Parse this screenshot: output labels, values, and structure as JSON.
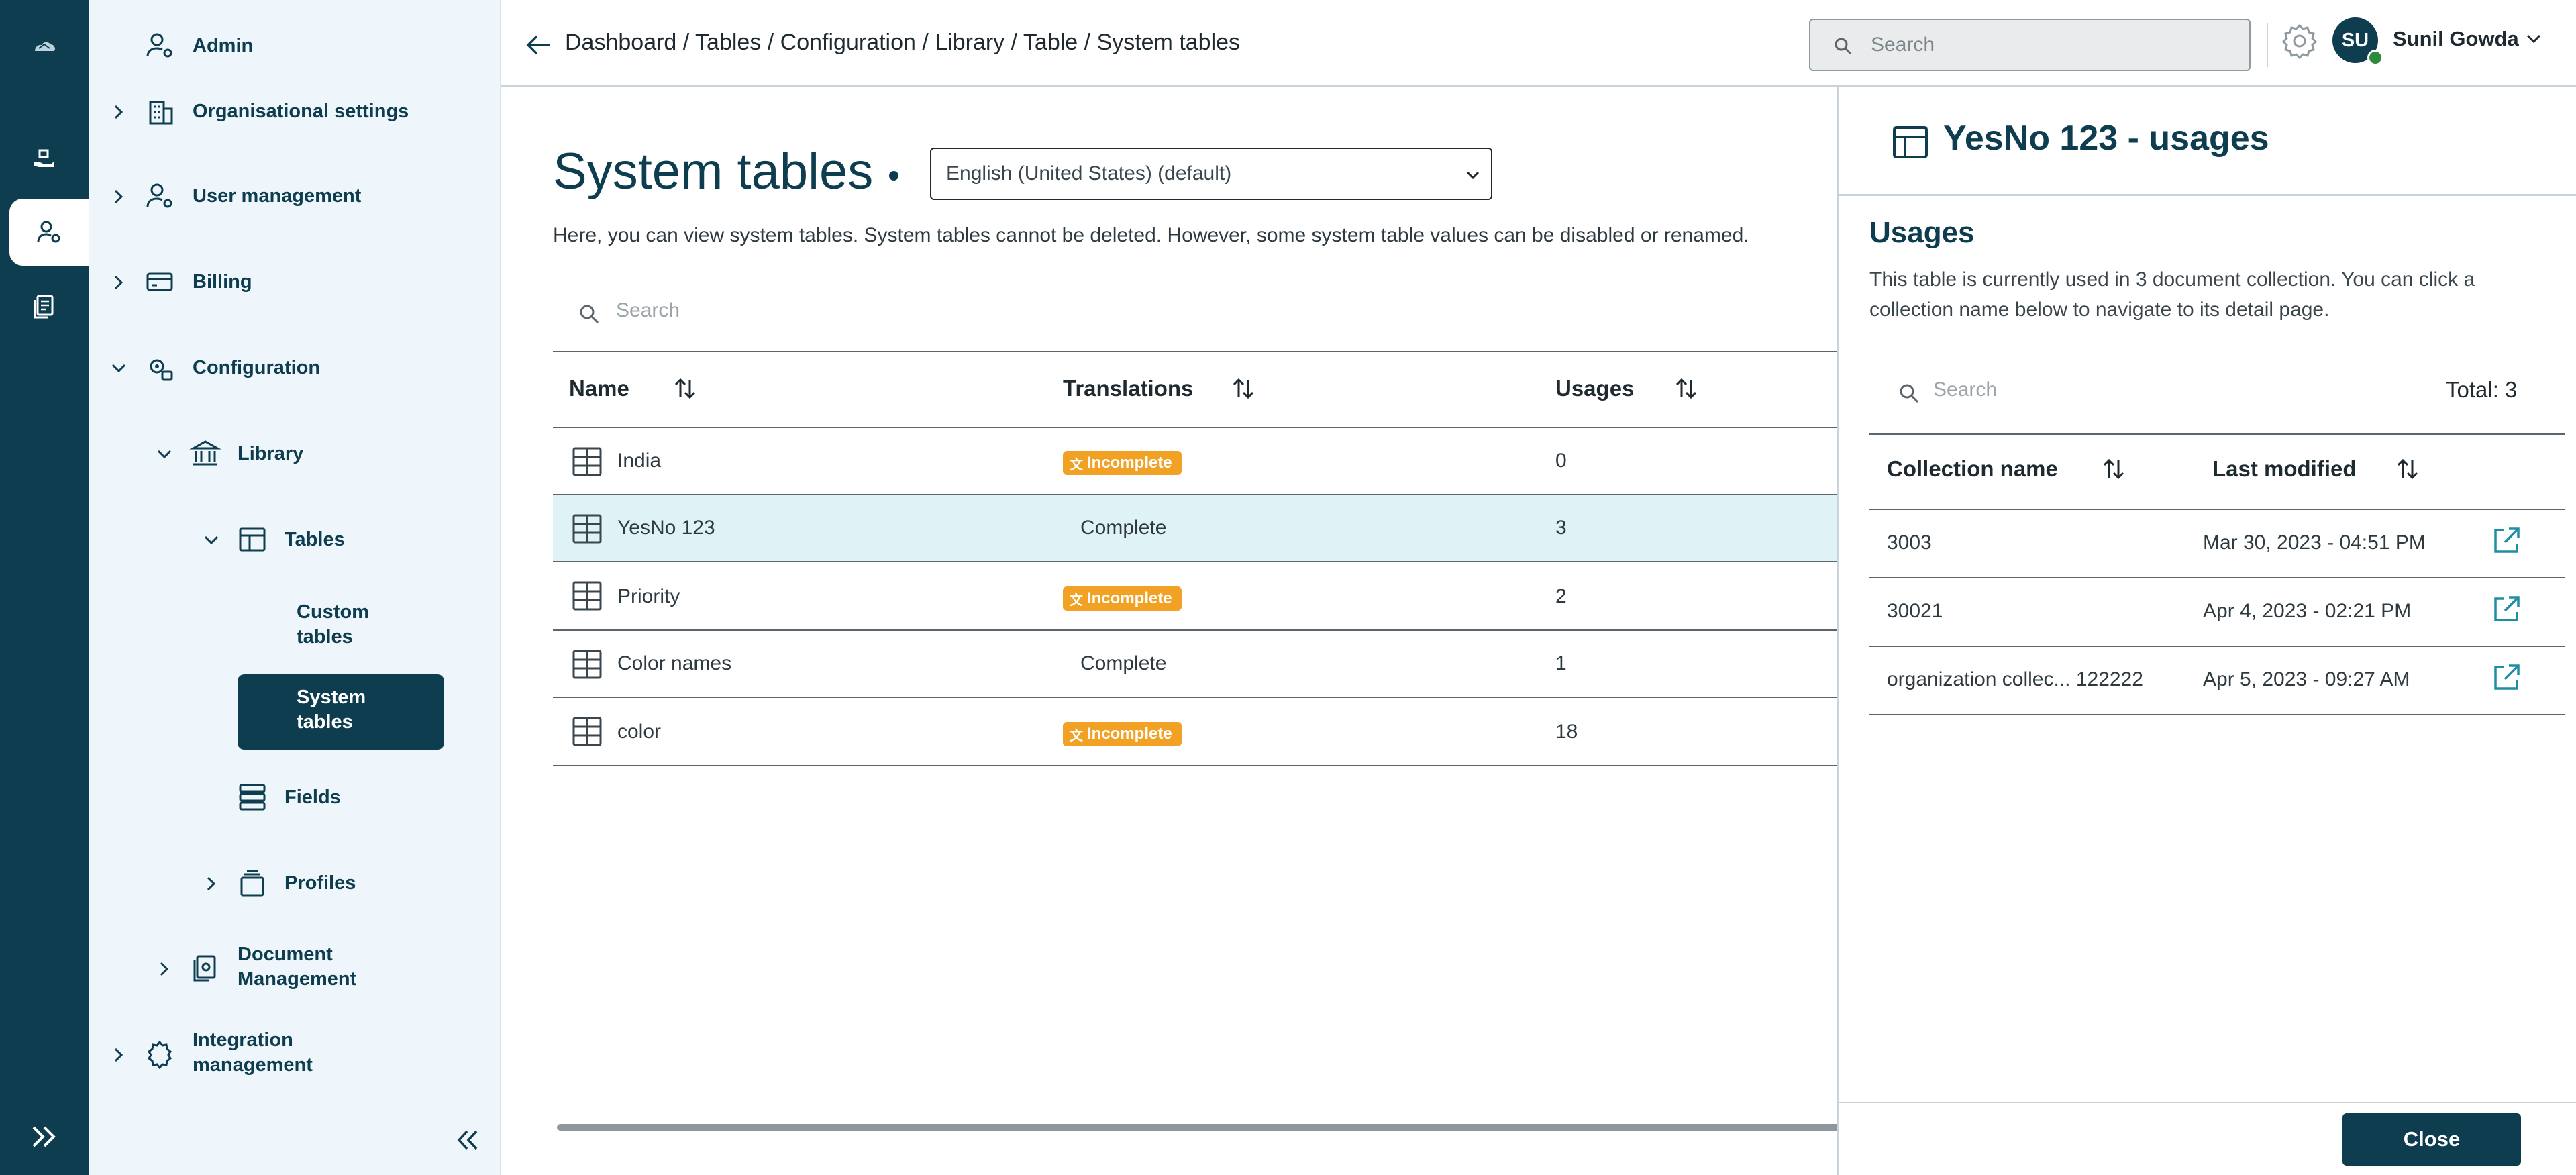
{
  "sidebar": {
    "admin": "Admin",
    "org_settings": "Organisational settings",
    "user_management": "User management",
    "billing": "Billing",
    "configuration": "Configuration",
    "library": "Library",
    "tables": "Tables",
    "custom_tables_1": "Custom",
    "custom_tables_2": "tables",
    "system_tables_1": "System",
    "system_tables_2": "tables",
    "fields": "Fields",
    "profiles": "Profiles",
    "doc_mgmt_1": "Document",
    "doc_mgmt_2": "Management",
    "integration_1": "Integration",
    "integration_2": "management"
  },
  "header": {
    "breadcrumb": "Dashboard / Tables / Configuration / Library / Table / System tables",
    "search_placeholder": "Search",
    "avatar_initials": "SU",
    "user_name": "Sunil Gowda"
  },
  "main": {
    "title": "System tables",
    "language": "English (United States) (default)",
    "description": "Here, you can view system tables. System tables cannot be deleted. However, some system table values can be disabled or renamed.",
    "search_placeholder": "Search",
    "columns": {
      "name": "Name",
      "translations": "Translations",
      "usages": "Usages"
    },
    "rows": [
      {
        "name": "India",
        "translation": "Incomplete",
        "usages": "0"
      },
      {
        "name": "YesNo 123",
        "translation": "Complete",
        "usages": "3"
      },
      {
        "name": "Priority",
        "translation": "Incomplete",
        "usages": "2"
      },
      {
        "name": "Color names",
        "translation": "Complete",
        "usages": "1"
      },
      {
        "name": "color",
        "translation": "Incomplete",
        "usages": "18"
      }
    ]
  },
  "panel": {
    "title": "YesNo 123 - usages",
    "section_heading": "Usages",
    "description": "This table is currently used in 3 document collection. You can click a collection name below to navigate to its detail page.",
    "search_placeholder": "Search",
    "total": "Total: 3",
    "columns": {
      "collection_name": "Collection name",
      "last_modified": "Last modified"
    },
    "rows": [
      {
        "name": "3003",
        "modified": "Mar 30, 2023 - 04:51 PM"
      },
      {
        "name": "30021",
        "modified": "Apr 4, 2023 - 02:21 PM"
      },
      {
        "name": "organization collec... 122222",
        "modified": "Apr 5, 2023 - 09:27 AM"
      }
    ],
    "close_label": "Close"
  },
  "colors": {
    "brand_dark": "#0d3d4f",
    "sidebar_bg": "#eef6fb",
    "incomplete_badge": "#f1a124",
    "selected_row": "#dff2f5",
    "link_teal": "#1f8ea3"
  }
}
